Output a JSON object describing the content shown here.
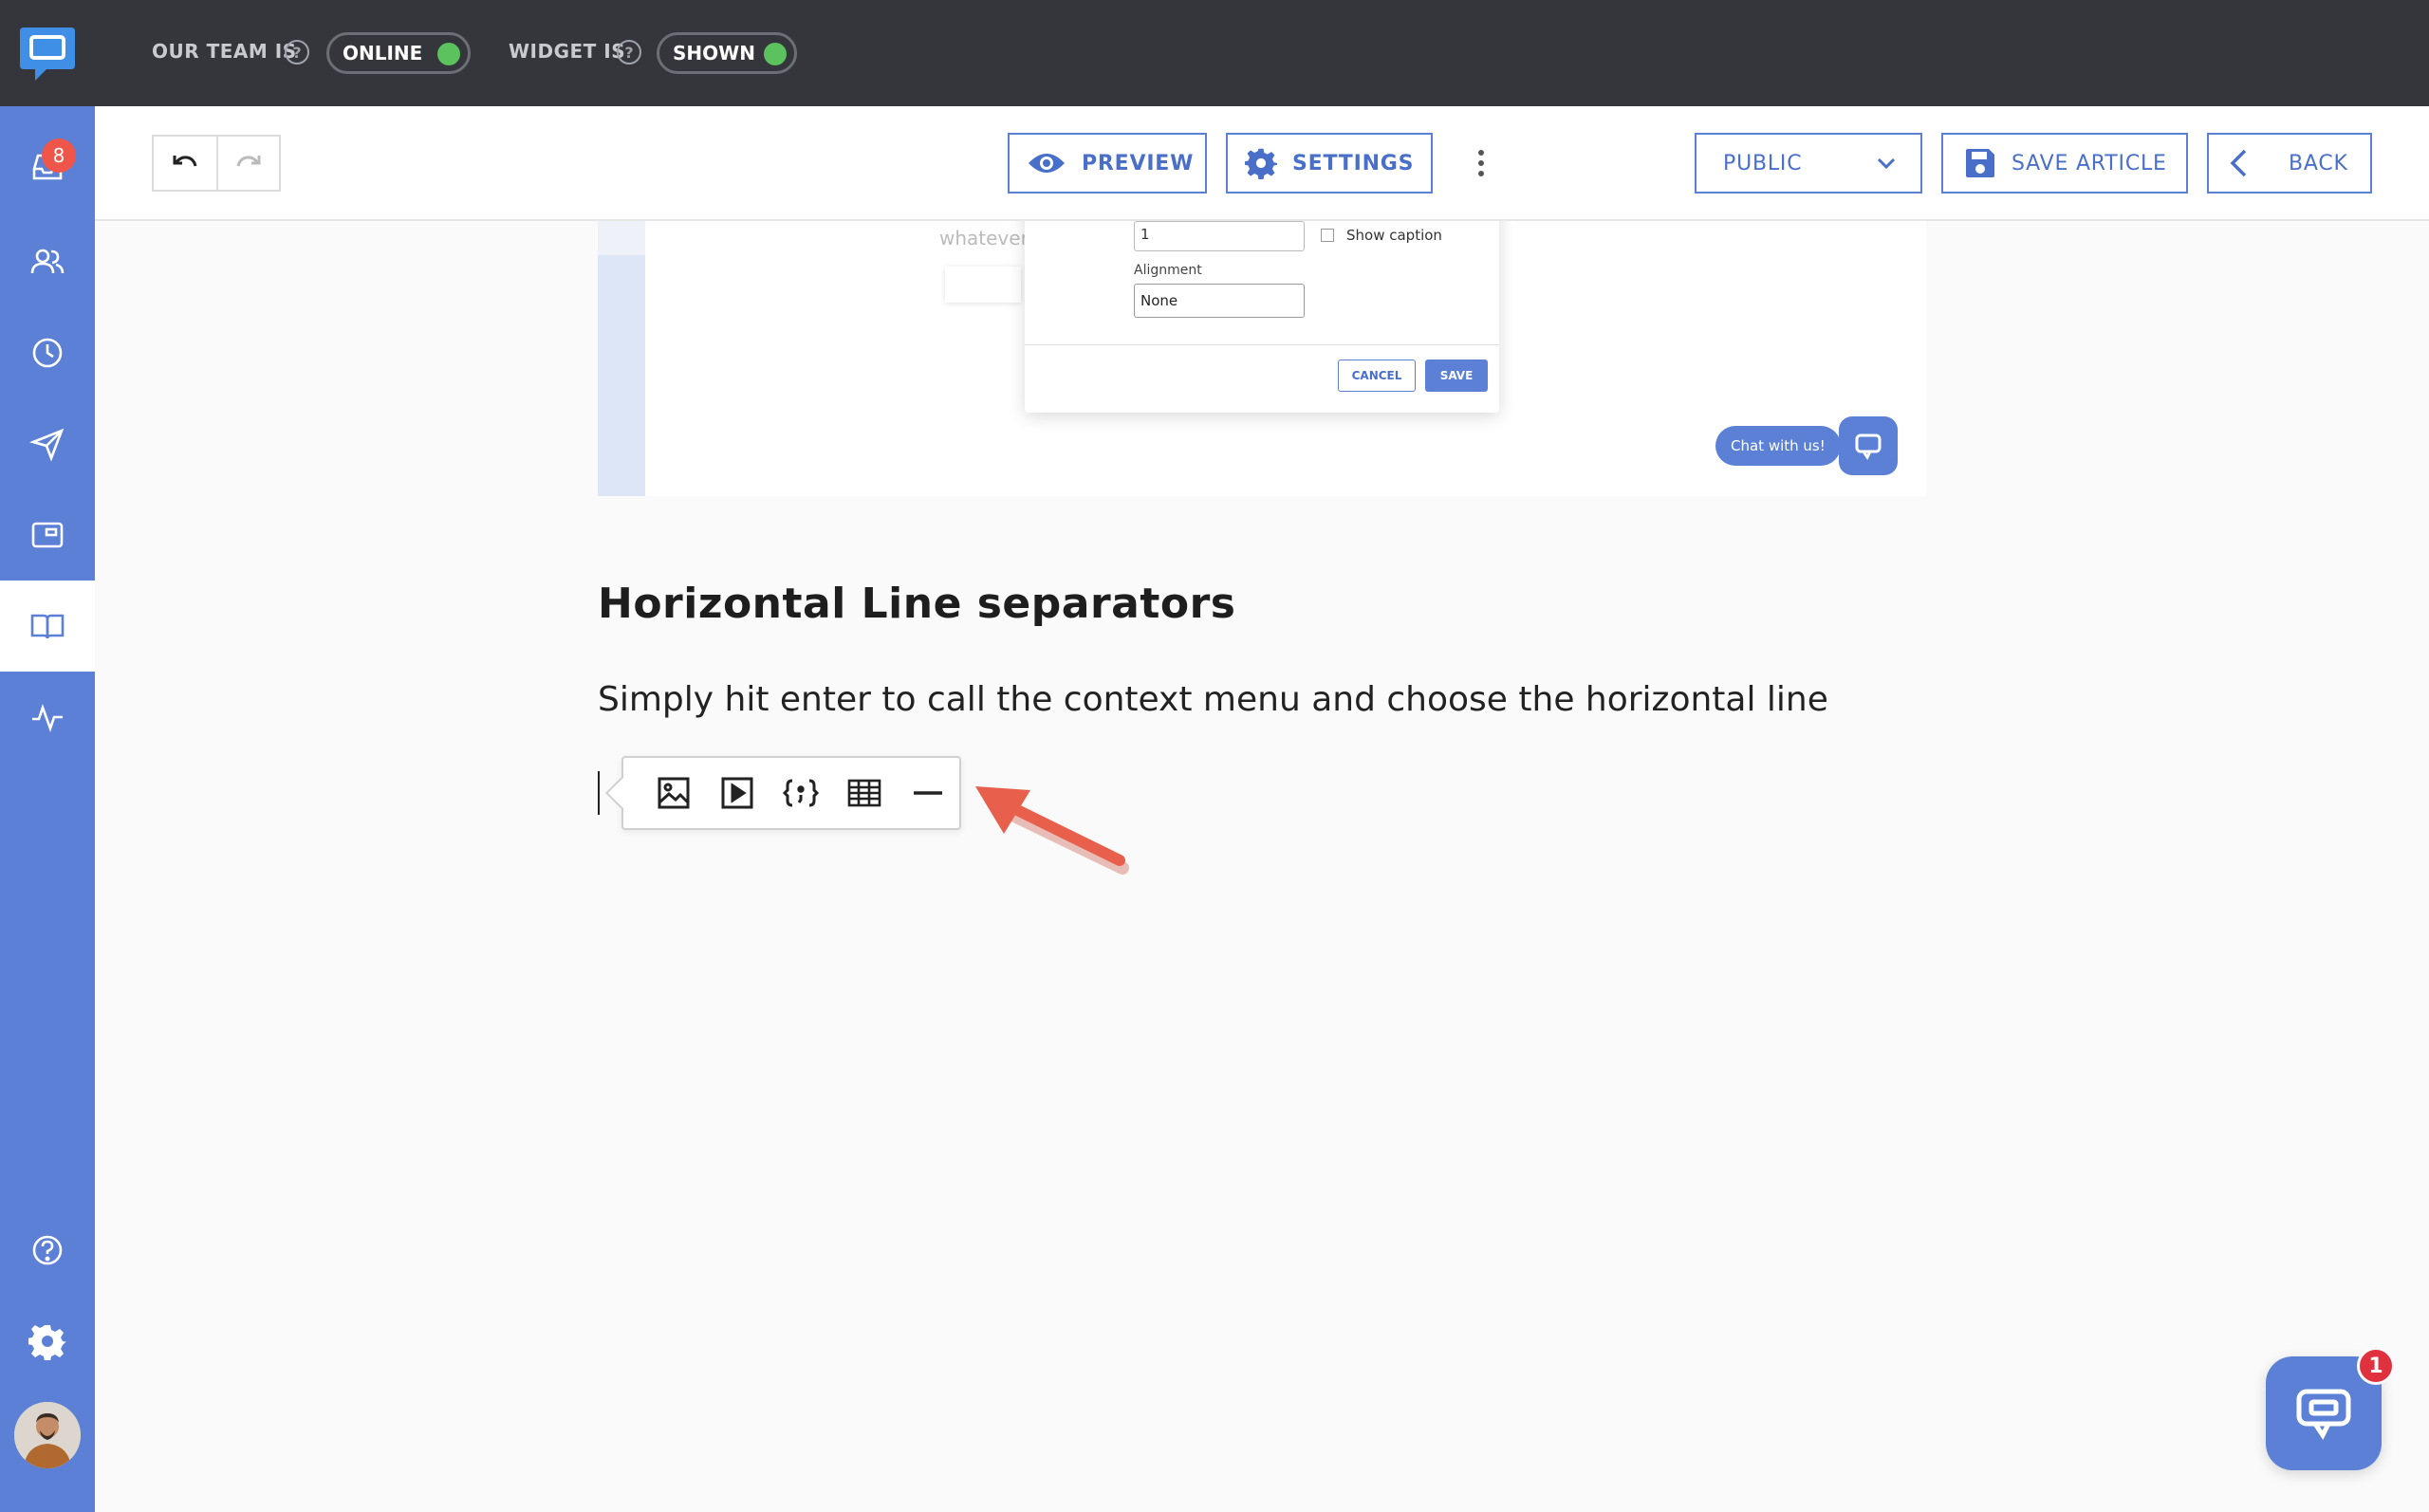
{
  "topbar": {
    "team_label": "OUR TEAM IS",
    "team_status": "ONLINE",
    "widget_label": "WIDGET IS",
    "widget_status": "SHOWN",
    "help_glyph": "?"
  },
  "sidebar": {
    "inbox_badge": "8",
    "items": [
      "inbox-icon",
      "users-icon",
      "clock-icon",
      "send-icon",
      "widget-icon",
      "book-icon",
      "activity-icon",
      "help-icon",
      "gear-icon"
    ],
    "active_item": "book-icon"
  },
  "toolbar": {
    "preview_label": "PREVIEW",
    "settings_label": "SETTINGS",
    "visibility_label": "PUBLIC",
    "save_label": "SAVE ARTICLE",
    "back_label": "BACK"
  },
  "embedded_screenshot": {
    "placeholder_text": "whatever",
    "field_value": "1",
    "show_caption_label": "Show caption",
    "alignment_label": "Alignment",
    "alignment_value": "None",
    "cancel_label": "CANCEL",
    "save_label": "SAVE",
    "chat_bubble": "Chat with us!"
  },
  "article": {
    "heading": "Horizontal Line separators",
    "paragraph": "Simply hit enter to call the context menu and choose the horizontal line",
    "context_menu": [
      "image-icon",
      "video-icon",
      "code-icon",
      "table-icon",
      "horizontal-line-icon"
    ]
  },
  "chat_launcher": {
    "badge": "1"
  },
  "colors": {
    "sidebar": "#5b80d6",
    "topbar": "#34363b",
    "accent": "#4a6fc9",
    "online": "#5bc25d",
    "badge": "#f0554a",
    "arrow": "#e8604c"
  }
}
